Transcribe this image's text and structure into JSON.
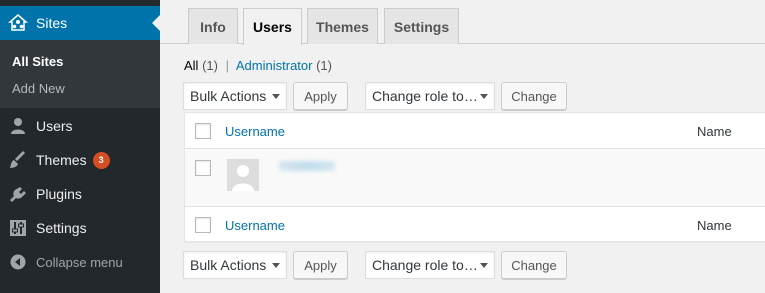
{
  "sidebar": {
    "sites": {
      "label": "Sites",
      "icon": "multisite-icon"
    },
    "submenu": {
      "all_sites": "All Sites",
      "add_new": "Add New"
    },
    "items": [
      {
        "label": "Users",
        "icon": "users-icon"
      },
      {
        "label": "Themes",
        "icon": "appearance-brush-icon",
        "badge": "3"
      },
      {
        "label": "Plugins",
        "icon": "plugins-icon"
      },
      {
        "label": "Settings",
        "icon": "settings-sliders-icon"
      }
    ],
    "collapse": {
      "label": "Collapse menu",
      "icon": "collapse-icon"
    }
  },
  "tabs": [
    {
      "label": "Info"
    },
    {
      "label": "Users",
      "active": true
    },
    {
      "label": "Themes"
    },
    {
      "label": "Settings"
    }
  ],
  "filters": {
    "all": {
      "label": "All",
      "count": "(1)"
    },
    "separator": "|",
    "administrator": {
      "label": "Administrator",
      "count": "(1)"
    }
  },
  "bulk_top": {
    "bulk_actions": "Bulk Actions",
    "apply": "Apply",
    "change_role": "Change role to…",
    "change": "Change"
  },
  "bulk_bottom": {
    "bulk_actions": "Bulk Actions",
    "apply": "Apply",
    "change_role": "Change role to…",
    "change": "Change"
  },
  "table": {
    "header": {
      "username": "Username",
      "name": "Name"
    },
    "footer": {
      "username": "Username",
      "name": "Name"
    }
  },
  "colors": {
    "accent": "#0073aa",
    "sidebar": "#23282d",
    "badge": "#d54e21"
  }
}
